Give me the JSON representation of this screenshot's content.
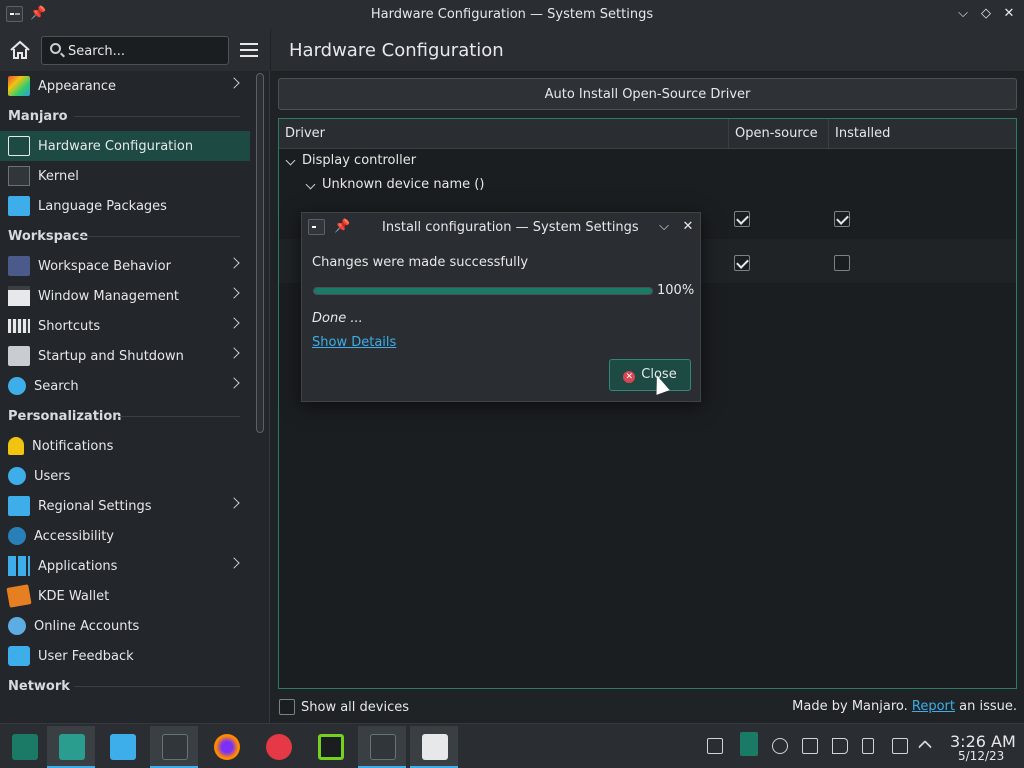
{
  "window": {
    "title": "Hardware Configuration — System Settings"
  },
  "sidebar": {
    "search_placeholder": "Search...",
    "top_item": {
      "label": "Appearance"
    },
    "sections": [
      {
        "title": "Manjaro",
        "items": [
          {
            "label": "Hardware Configuration"
          },
          {
            "label": "Kernel"
          },
          {
            "label": "Language Packages"
          }
        ]
      },
      {
        "title": "Workspace",
        "items": [
          {
            "label": "Workspace Behavior"
          },
          {
            "label": "Window Management"
          },
          {
            "label": "Shortcuts"
          },
          {
            "label": "Startup and Shutdown"
          },
          {
            "label": "Search"
          }
        ]
      },
      {
        "title": "Personalization",
        "items": [
          {
            "label": "Notifications"
          },
          {
            "label": "Users"
          },
          {
            "label": "Regional Settings"
          },
          {
            "label": "Accessibility"
          },
          {
            "label": "Applications"
          },
          {
            "label": "KDE Wallet"
          },
          {
            "label": "Online Accounts"
          },
          {
            "label": "User Feedback"
          }
        ]
      },
      {
        "title": "Network",
        "items": []
      }
    ]
  },
  "main": {
    "page_title": "Hardware Configuration",
    "auto_install_label": "Auto Install Open-Source Driver",
    "table": {
      "columns": [
        "Driver",
        "Open-source",
        "Installed"
      ],
      "category": "Display controller",
      "device": "Unknown device name ()",
      "rows": [
        {
          "open_source": true,
          "installed": true
        },
        {
          "open_source": true,
          "installed": false
        }
      ]
    },
    "show_all_devices_label": "Show all devices",
    "footer": {
      "prefix": "Made by Manjaro.",
      "link": "Report",
      "suffix": "an issue."
    }
  },
  "dialog": {
    "title": "Install configuration — System Settings",
    "message": "Changes were made successfully",
    "progress_percent": 100,
    "progress_label": "100%",
    "status": "Done ...",
    "details_link": "Show Details",
    "close_label": "Close"
  },
  "taskbar": {
    "time": "3:26 AM",
    "date": "5/12/23"
  },
  "colors": {
    "accent": "#3daee9",
    "selection": "#1d4a42",
    "progress": "#1b7a66",
    "close_icon": "#da4453"
  }
}
